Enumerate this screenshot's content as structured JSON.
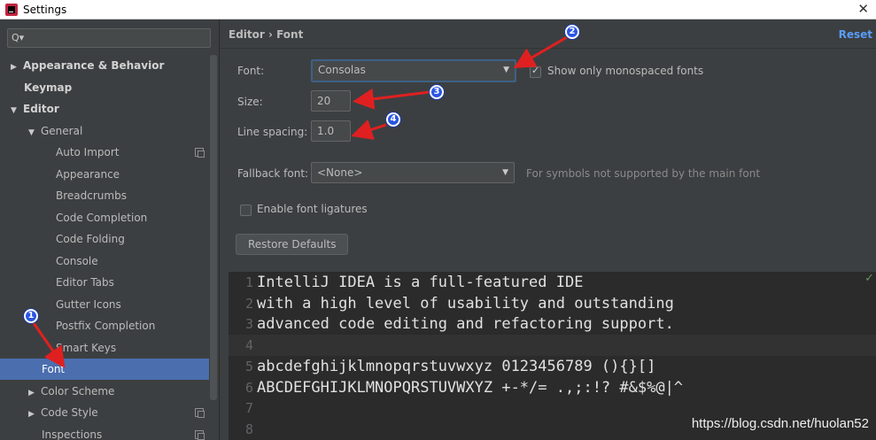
{
  "window": {
    "title": "Settings",
    "close_icon": "close-icon"
  },
  "sidebar": {
    "search_placeholder": "",
    "items": [
      {
        "label": "Appearance & Behavior",
        "level": 0,
        "arrow": "▶",
        "bold": true
      },
      {
        "label": "Keymap",
        "level": 0,
        "arrow": "",
        "bold": true
      },
      {
        "label": "Editor",
        "level": 0,
        "arrow": "▼",
        "bold": true
      },
      {
        "label": "General",
        "level": 1,
        "arrow": "▼"
      },
      {
        "label": "Auto Import",
        "level": 2,
        "arrow": "",
        "copy_icon": true
      },
      {
        "label": "Appearance",
        "level": 2,
        "arrow": ""
      },
      {
        "label": "Breadcrumbs",
        "level": 2,
        "arrow": ""
      },
      {
        "label": "Code Completion",
        "level": 2,
        "arrow": ""
      },
      {
        "label": "Code Folding",
        "level": 2,
        "arrow": ""
      },
      {
        "label": "Console",
        "level": 2,
        "arrow": ""
      },
      {
        "label": "Editor Tabs",
        "level": 2,
        "arrow": ""
      },
      {
        "label": "Gutter Icons",
        "level": 2,
        "arrow": ""
      },
      {
        "label": "Postfix Completion",
        "level": 2,
        "arrow": ""
      },
      {
        "label": "Smart Keys",
        "level": 2,
        "arrow": ""
      },
      {
        "label": "Font",
        "level": 1,
        "arrow": "",
        "selected": true
      },
      {
        "label": "Color Scheme",
        "level": 1,
        "arrow": "▶"
      },
      {
        "label": "Code Style",
        "level": 1,
        "arrow": "▶",
        "copy_icon": true
      },
      {
        "label": "Inspections",
        "level": 1,
        "arrow": "",
        "copy_icon": true
      }
    ]
  },
  "header": {
    "breadcrumb": "Editor  ›  Font",
    "reset_label": "Reset"
  },
  "form": {
    "font_label": "Font:",
    "font_value": "Consolas",
    "monospace_label": "Show only monospaced fonts",
    "monospace_checked": true,
    "size_label": "Size:",
    "size_value": "20",
    "line_spacing_label": "Line spacing:",
    "line_spacing_value": "1.0",
    "fallback_label": "Fallback font:",
    "fallback_value": "<None>",
    "fallback_hint": "For symbols not supported by the main font",
    "ligatures_label": "Enable font ligatures",
    "ligatures_checked": false,
    "restore_label": "Restore Defaults"
  },
  "preview": {
    "lines": [
      {
        "num": "1",
        "text": "IntelliJ IDEA is a full-featured IDE"
      },
      {
        "num": "2",
        "text": "with a high level of usability and outstanding"
      },
      {
        "num": "3",
        "text": "advanced code editing and refactoring support."
      },
      {
        "num": "4",
        "text": ""
      },
      {
        "num": "5",
        "text": "abcdefghijklmnopqrstuvwxyz 0123456789 (){}[]"
      },
      {
        "num": "6",
        "text": "ABCDEFGHIJKLMNOPQRSTUVWXYZ +-*/= .,;:!? #&$%@|^"
      },
      {
        "num": "7",
        "text": ""
      },
      {
        "num": "8",
        "text": ""
      }
    ],
    "current_line": "4"
  },
  "annotations": {
    "markers": [
      "1",
      "2",
      "3",
      "4"
    ],
    "color": "#e02020",
    "badge_color": "#2a55e5"
  },
  "watermark": "https://blog.csdn.net/huolan52"
}
